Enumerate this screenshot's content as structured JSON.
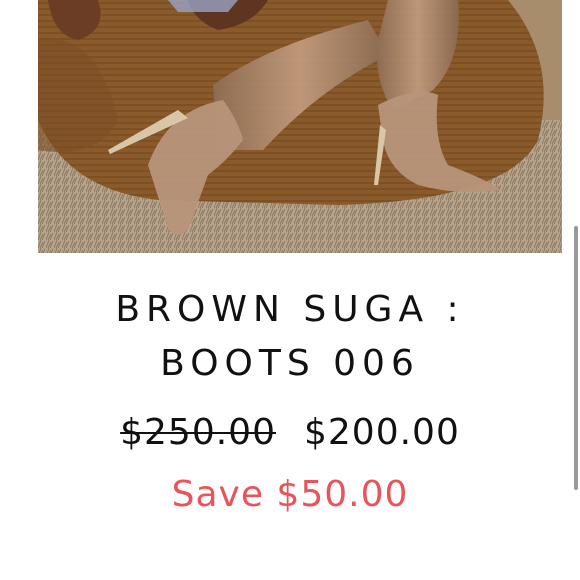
{
  "product": {
    "image_alt": "Brown transparent knee-high stiletto boots on a velvet cushion over a shag rug",
    "title_line1": "BROWN SUGA :",
    "title_line2": "BOOTS 006",
    "original_price": "$250.00",
    "sale_price": "$200.00",
    "savings": "Save $50.00"
  },
  "colors": {
    "title": "#111111",
    "price": "#111111",
    "savings": "#e8545a"
  }
}
